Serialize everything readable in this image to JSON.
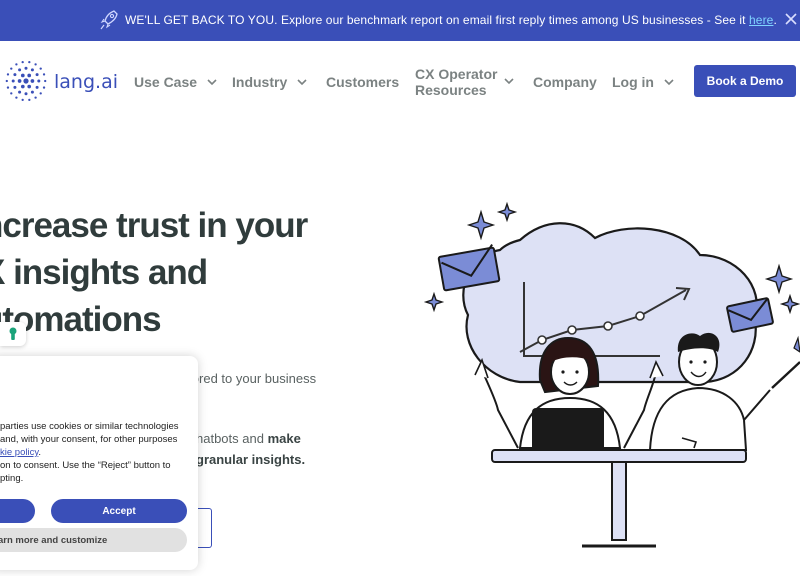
{
  "banner": {
    "text": "WE'LL GET BACK TO YOU. Explore our benchmark report on email first reply times among US businesses - See it ",
    "link": "here",
    "end": "."
  },
  "nav": {
    "logo_text": "lang.ai",
    "items": [
      {
        "label": "Use Case"
      },
      {
        "label": "Industry"
      },
      {
        "label": "Customers"
      },
      {
        "label": "Company"
      },
      {
        "label": "Log in"
      }
    ],
    "cx_line1": "CX Operator",
    "cx_line2": "Resources",
    "demo_label": "Book a Demo"
  },
  "hero": {
    "headline_l1": "ncrease trust in your",
    "headline_l2": "X insights and",
    "headline_l3": "utomations",
    "sub1": "ilored to your business",
    "sub2_a": "hatbots and ",
    "sub2_b": "make",
    "sub3": "granular insights."
  },
  "cookie": {
    "line1": "parties use cookies or similar technologies",
    "line2": "and, with your consent, for other purposes",
    "line3_link": "kie policy",
    "line3_end": ".",
    "line4": "on to consent. Use the “Reject” button to",
    "line5": "pting.",
    "accept": "Accept",
    "learn": "arn more and customize"
  },
  "colors": {
    "brand": "#3a4fb8",
    "link": "#7fd3ff"
  }
}
